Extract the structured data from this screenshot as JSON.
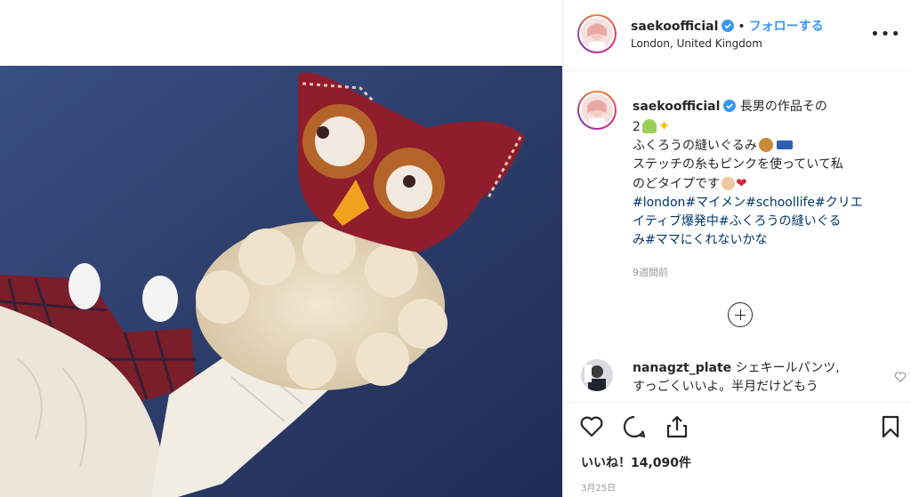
{
  "post": {
    "username": "saekoofficial",
    "separator": "•",
    "follow_label": "フォローする",
    "location": "London, United Kingdom",
    "more_label": "•••"
  },
  "caption": {
    "username": "saekoofficial",
    "line1": "長男の作品その",
    "line2": "2",
    "line3": "ふくろうの縫いぐるみ",
    "line4": "ステッチの糸もピンクを使っていて私",
    "line5": "のどタイプです",
    "hashtags_line1": "#london#マイメン#schoollife#クリエ",
    "hashtags_line2": "イティブ爆発中#ふくろうの縫いぐる",
    "hashtags_line3": "み#ママにくれないかな",
    "time_ago": "9週間前"
  },
  "comment": {
    "username": "nanagzt_plate",
    "text_line1": "シェキールパンツ,",
    "text_line2": "すっごくいいよ。半月だけどもう"
  },
  "stats": {
    "likes": "いいね！14,090件",
    "date": "3月25日"
  },
  "icons": {
    "more": "more-options-icon",
    "add_comment": "plus-circle-icon",
    "like": "heart-icon",
    "comment": "speech-bubble-icon",
    "share": "share-icon",
    "save": "bookmark-icon",
    "verified": "verified-badge-icon"
  },
  "colors": {
    "link_blue": "#3897f0",
    "hashtag": "#003569",
    "muted": "#999999",
    "text": "#262626"
  }
}
